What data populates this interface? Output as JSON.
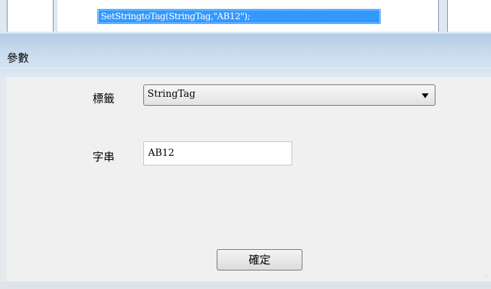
{
  "script": {
    "selected_line": "SetStringtoTag(StringTag,\"AB12\");"
  },
  "panel": {
    "title": "參數",
    "tag_label": "標籤",
    "tag_value": "StringTag",
    "string_label": "字串",
    "string_value": "AB12",
    "ok_label": "確定"
  },
  "icons": {
    "dropdown": "chevron-down-icon",
    "resize": "resize-grip-icon"
  },
  "colors": {
    "selection": "#3399ff",
    "header_gradient_top": "#b4cbe4",
    "panel_background": "#f0f0f0"
  }
}
